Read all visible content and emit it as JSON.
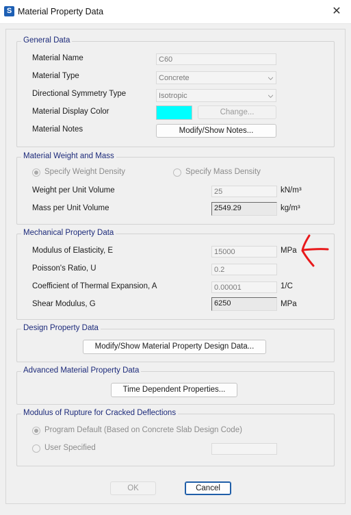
{
  "window": {
    "app_icon_letter": "S",
    "title": "Material Property Data",
    "close_glyph": "✕"
  },
  "general": {
    "title": "General Data",
    "material_name": {
      "label": "Material Name",
      "value": "C60"
    },
    "material_type": {
      "label": "Material Type",
      "value": "Concrete"
    },
    "directional_symmetry": {
      "label": "Directional Symmetry Type",
      "value": "Isotropic"
    },
    "display_color": {
      "label": "Material Display Color",
      "color": "#00ffff",
      "change_button": "Change..."
    },
    "notes": {
      "label": "Material Notes",
      "button": "Modify/Show Notes..."
    }
  },
  "weight_mass": {
    "title": "Material Weight and Mass",
    "radio_weight": "Specify Weight Density",
    "radio_mass": "Specify Mass Density",
    "weight": {
      "label": "Weight per Unit Volume",
      "value": "25",
      "unit": "kN/m³"
    },
    "mass": {
      "label": "Mass per Unit Volume",
      "value": "2549.29",
      "unit": "kg/m³"
    }
  },
  "mechanical": {
    "title": "Mechanical Property Data",
    "modulus": {
      "label": "Modulus of Elasticity,  E",
      "value": "15000",
      "unit": "MPa"
    },
    "poisson": {
      "label": "Poisson's Ratio,  U",
      "value": "0.2",
      "unit": ""
    },
    "thermal": {
      "label": "Coefficient of Thermal Expansion,  A",
      "value": "0.00001",
      "unit": "1/C"
    },
    "shear": {
      "label": "Shear Modulus,  G",
      "value": "6250",
      "unit": "MPa"
    }
  },
  "design": {
    "title": "Design Property Data",
    "button": "Modify/Show Material Property Design Data..."
  },
  "advanced": {
    "title": "Advanced Material Property Data",
    "button": "Time Dependent Properties..."
  },
  "rupture": {
    "title": "Modulus of Rupture for Cracked Deflections",
    "radio_default": "Program Default  (Based on Concrete Slab Design Code)",
    "radio_user": "User Specified",
    "user_value": ""
  },
  "footer": {
    "ok": "OK",
    "cancel": "Cancel"
  },
  "colors": {
    "group_title": "#1c2a7a",
    "annotation_arrow": "#e8191b",
    "default_button_border": "#1f5ea8"
  }
}
